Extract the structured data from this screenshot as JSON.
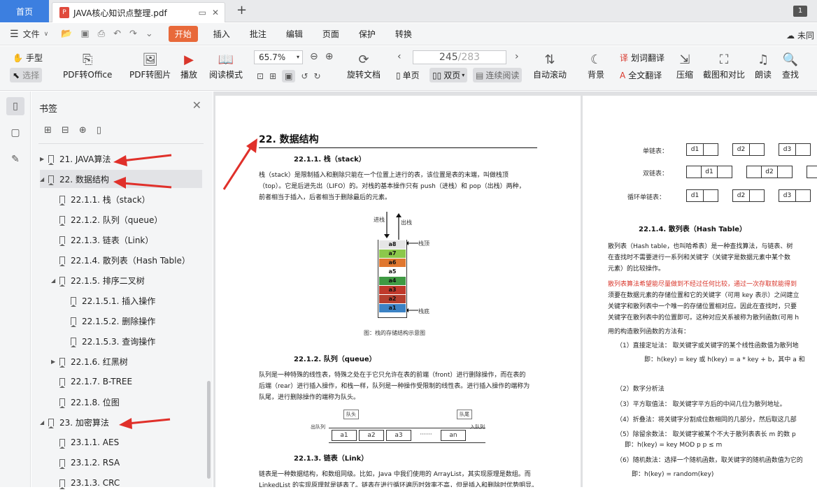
{
  "tabs": {
    "home": "首页",
    "doc": "JAVA核心知识点整理.pdf",
    "count": "1"
  },
  "menu": {
    "file": "文件",
    "items": [
      "开始",
      "插入",
      "批注",
      "编辑",
      "页面",
      "保护",
      "转换"
    ],
    "account": "未同"
  },
  "toolbar": {
    "hand": "手型",
    "select": "选择",
    "pdf_office": "PDF转Office",
    "pdf_image": "PDF转图片",
    "play": "播放",
    "read_mode": "阅读模式",
    "zoom": "65.7%",
    "rotate": "旋转文档",
    "page_current": "245",
    "page_total": "/283",
    "single": "单页",
    "double": "双页",
    "continuous": "连续阅读",
    "auto_scroll": "自动滚动",
    "background": "背景",
    "word_translate": "划词翻译",
    "full_translate": "全文翻译",
    "compress": "压缩",
    "screenshot_compare": "截图和对比",
    "read_aloud": "朗读",
    "find": "查找"
  },
  "bookmarks": {
    "title": "书签",
    "items": [
      "21. JAVA算法",
      "22. 数据结构",
      "22.1.1. 栈（stack）",
      "22.1.2. 队列（queue）",
      "22.1.3. 链表（Link）",
      "22.1.4. 散列表（Hash Table）",
      "22.1.5. 排序二叉树",
      "22.1.5.1. 插入操作",
      "22.1.5.2. 删除操作",
      "22.1.5.3. 查询操作",
      "22.1.6. 红黑树",
      "22.1.7. B-TREE",
      "22.1.8. 位图",
      "23. 加密算法",
      "23.1.1. AES",
      "23.1.2. RSA",
      "23.1.3. CRC"
    ]
  },
  "page1": {
    "heading": "22.  数据结构",
    "s1_title": "22.1.1.    栈（stack）",
    "s1_p1": "栈（stack）是限制插入和删除只能在一个位置上进行的表，该位置是表的末端，叫做栈顶",
    "s1_p2": "（top）。它是后进先出（LIFO）的。对栈的基本操作只有 push（进栈）和 pop（出栈）两种，",
    "s1_p3": "前者相当于插入，后者相当于删除最后的元素。",
    "push": "进栈",
    "pop": "出栈",
    "top": "栈顶",
    "bottom": "栈底",
    "stack_cells": [
      "a8",
      "a7",
      "a6",
      "a5",
      "a4",
      "a3",
      "a2",
      "a1"
    ],
    "stack_colors": [
      "#e6e6e6",
      "#8cc84b",
      "#e0772f",
      "#ffffff",
      "#3f9a43",
      "#c0392b",
      "#b5402f",
      "#3b82c4"
    ],
    "stack_caption": "图：栈的存储结构示意图",
    "s2_title": "22.1.2.    队列（queue）",
    "s2_p1": "队列是一种特殊的线性表，特殊之处在于它只允许在表的前端（front）进行删除操作，而在表的",
    "s2_p2": "后端（rear）进行插入操作，和栈一样，队列是一种操作受限制的线性表。进行插入操作的端称为",
    "s2_p3": "队尾，进行删除操作的端称为队头。",
    "q_head": "队头",
    "q_tail": "队尾",
    "q_out": "出队列",
    "q_in": "入队列",
    "q_cells": [
      "a1",
      "a2",
      "a3",
      "······",
      "an"
    ],
    "s3_title": "22.1.3.    链表（Link）",
    "s3_p1": "链表是一种数据结构，和数组同级。比如，Java 中我们使用的 ArrayList，其实现原理是数组。而",
    "s3_p2": "LinkedList 的实现原理就是链表了。链表在进行循环遍历时效率不高，但是插入和删除时优势明显。"
  },
  "page2": {
    "single": "单链表：",
    "double": "双链表：",
    "circular": "循环单链表：",
    "nodes": [
      "d1",
      "d2",
      "d3"
    ],
    "s4_title": "22.1.4.    散列表（Hash Table）",
    "p1": "散列表（Hash table，也叫哈希表）是一种查找算法，与链表、树",
    "p2": "在查找时不需要进行一系列和关键字（关键字是数据元素中某个数",
    "p3": "元素）的比较操作。",
    "red1": "散列表算法希望能尽量做到不经过任何比较，通过一次存取就能得到",
    "p4": "须要在数据元素的存储位置和它的关键字（可用 key 表示）之间建立",
    "p5": "关键字和散列表中一个唯一的存储位置相对应。因此在查找时，只要",
    "p6": "关键字在散列表中的位置即可。这种对应关系被称为散列函数(可用 h",
    "p7": "用的构造散列函数的方法有：",
    "m1": "（1）直接定址法：  取关键字或关键字的某个线性函数值为散列地",
    "m1b": "即：h(key) = key   或 h(key) = a * key + b，其中 a 和",
    "m2": "（2）数字分析法",
    "m3": "（3）平方取值法：  取关键字平方后的中间几位为散列地址。",
    "m4": "（4）折叠法：将关键字分割成位数相同的几部分，然后取这几部",
    "m5": "（5）除留余数法：  取关键字被某个不大于散列表表长 m 的数 p",
    "m5b": "即：h(key) = key MOD p    p ≤ m",
    "m6": "（6）随机数法：选择一个随机函数，取关键字的随机函数值为它的",
    "m6b": "即：h(key) = random(key)"
  }
}
